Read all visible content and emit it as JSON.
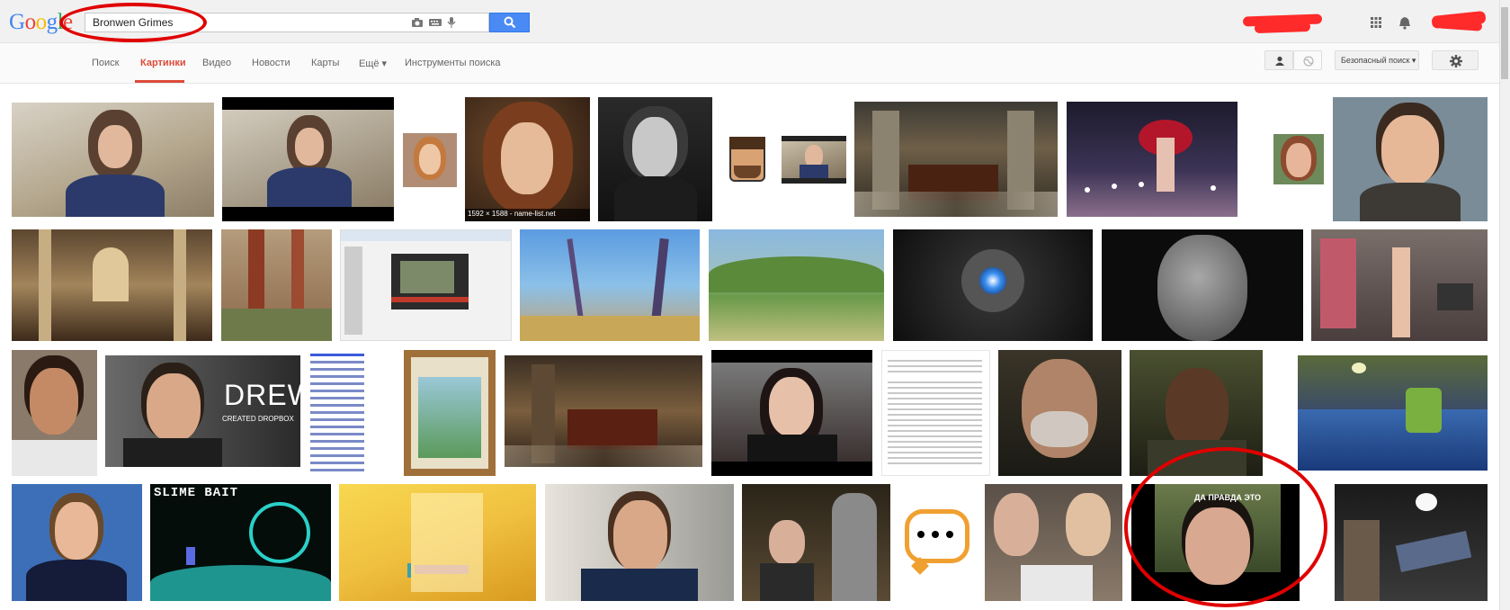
{
  "logo": {
    "letters": [
      "G",
      "o",
      "o",
      "g",
      "l",
      "e"
    ]
  },
  "search": {
    "query": "Bronwen Grimes"
  },
  "tabs": [
    {
      "label": "Поиск"
    },
    {
      "label": "Картинки"
    },
    {
      "label": "Видео"
    },
    {
      "label": "Новости"
    },
    {
      "label": "Карты"
    },
    {
      "label": "Ещё ▾"
    },
    {
      "label": "Инструменты поиска"
    }
  ],
  "toolbar": {
    "safe_search_label": "Безопасный поиск ▾"
  },
  "results": {
    "thumb_caption": "1592 × 1588 - name-list.net",
    "drew_title": "DREW",
    "drew_subtitle": "CREATED DROPBOX",
    "slime_title": "SLIME BAIT",
    "meme_caption": "ДА ПРАВДА ЭТО"
  },
  "colors": {
    "accent_red": "#dd4b39",
    "search_blue": "#4a8af4",
    "annotation_red": "#e00000"
  }
}
